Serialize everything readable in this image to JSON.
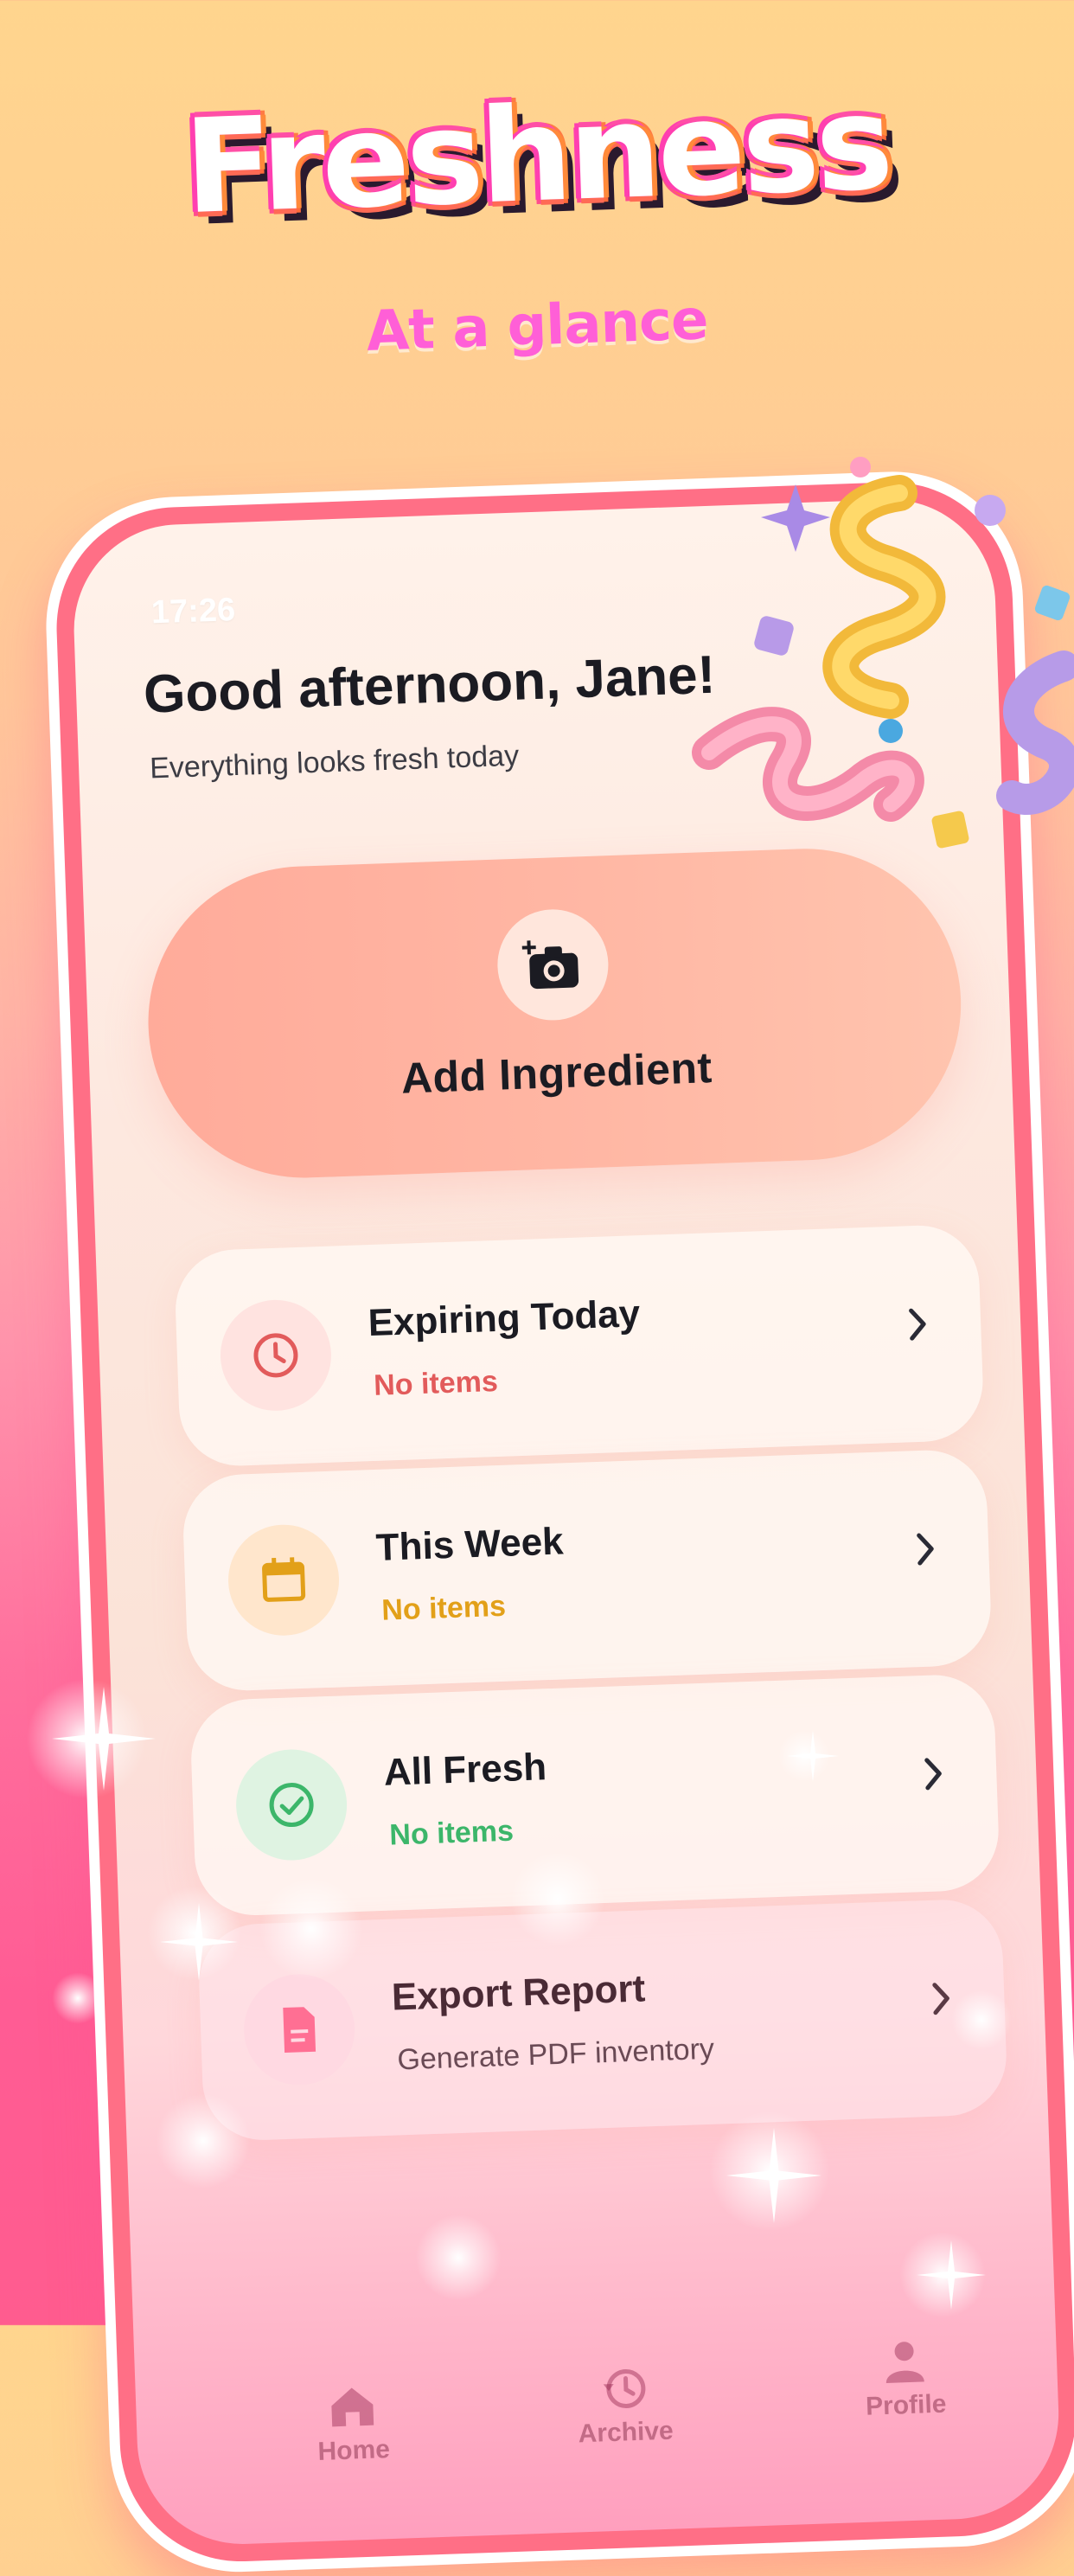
{
  "promo": {
    "title": "Freshness",
    "subtitle": "At a glance"
  },
  "status_bar": {
    "time": "17:26"
  },
  "header": {
    "greeting": "Good afternoon, Jane!",
    "subtitle": "Everything looks fresh today"
  },
  "add_ingredient": {
    "label": "Add Ingredient",
    "icon": "camera-plus-icon"
  },
  "cards": [
    {
      "title": "Expiring Today",
      "sub": "No items",
      "icon": "clock-icon",
      "accent": "#e25b5b",
      "bubble": "#ffe3e0"
    },
    {
      "title": "This Week",
      "sub": "No items",
      "icon": "calendar-icon",
      "accent": "#e2a019",
      "bubble": "#ffe6cc"
    },
    {
      "title": "All Fresh",
      "sub": "No items",
      "icon": "check-circle-icon",
      "accent": "#3cb66a",
      "bubble": "#dff3e2"
    },
    {
      "title": "Export Report",
      "sub": "Generate PDF inventory",
      "icon": "document-icon",
      "accent": "#ff6f93",
      "bubble": "#ffd9e2"
    }
  ],
  "tabbar": {
    "items": [
      {
        "label": "Home",
        "icon": "home-icon"
      },
      {
        "label": "Archive",
        "icon": "history-icon"
      },
      {
        "label": "Profile",
        "icon": "person-icon"
      }
    ]
  },
  "colors": {
    "frame": "#ff6f86",
    "text_dark": "#1b1b22"
  }
}
